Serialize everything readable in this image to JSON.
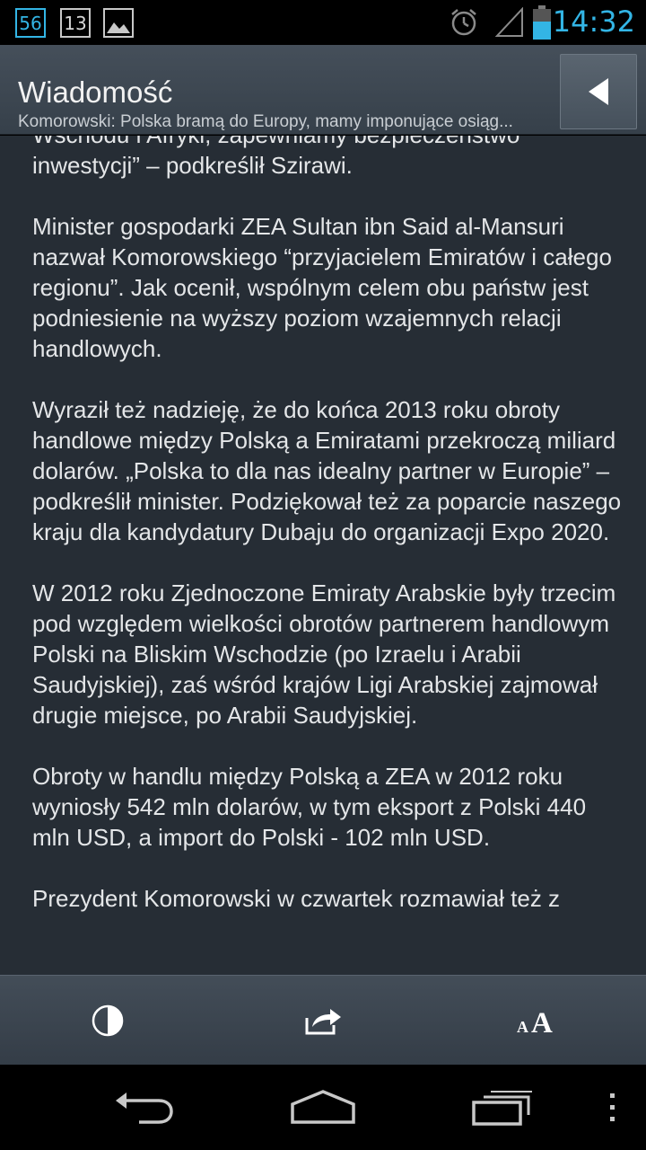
{
  "status_bar": {
    "notif_count_1": "56",
    "notif_count_2": "13",
    "time": "14:32",
    "accent_color": "#33b5e5",
    "icons": [
      "image-icon",
      "alarm-icon",
      "signal-icon",
      "battery-icon"
    ]
  },
  "action_bar": {
    "title": "Wiadomość",
    "subtitle": "Komorowski: Polska bramą do Europy, mamy imponujące osiąg...",
    "back_icon": "back-triangle-icon"
  },
  "article": {
    "paragraphs": [
      "Wschodu i Afryki, zapewniamy bezpieczeństwo inwestycji” – podkreślił Szirawi.",
      "Minister gospodarki ZEA Sultan ibn Said al-Mansuri nazwał Komorowskiego “przyjacielem Emiratów i całego regionu”. Jak ocenił, wspólnym celem obu państw jest podniesienie na wyższy poziom wzajemnych relacji handlowych.",
      "Wyraził też nadzieję, że do końca 2013 roku obroty handlowe między Polską a Emiratami przekroczą miliard dolarów. „Polska to dla nas idealny partner w Europie” – podkreślił minister. Podziękował też za poparcie naszego kraju dla kandydatury Dubaju do organizacji Expo 2020.",
      "W 2012 roku Zjednoczone Emiraty Arabskie były trzecim pod względem wielkości obrotów partnerem handlowym Polski na Bliskim Wschodzie (po Izraelu i Arabii Saudyjskiej), zaś wśród krajów Ligi Arabskiej zajmował drugie miejsce, po Arabii Saudyjskiej.",
      "Obroty w handlu między Polską a ZEA w 2012 roku wyniosły 542 mln dolarów, w tym eksport z Polski 440 mln USD, a import do Polski - 102 mln USD.",
      "Prezydent Komorowski w czwartek rozmawiał też z"
    ]
  },
  "toolbar": {
    "icons": [
      "contrast-icon",
      "share-icon",
      "font-size-icon"
    ]
  },
  "nav_bar": {
    "icons": [
      "back-icon",
      "home-icon",
      "recent-apps-icon",
      "menu-icon"
    ]
  }
}
